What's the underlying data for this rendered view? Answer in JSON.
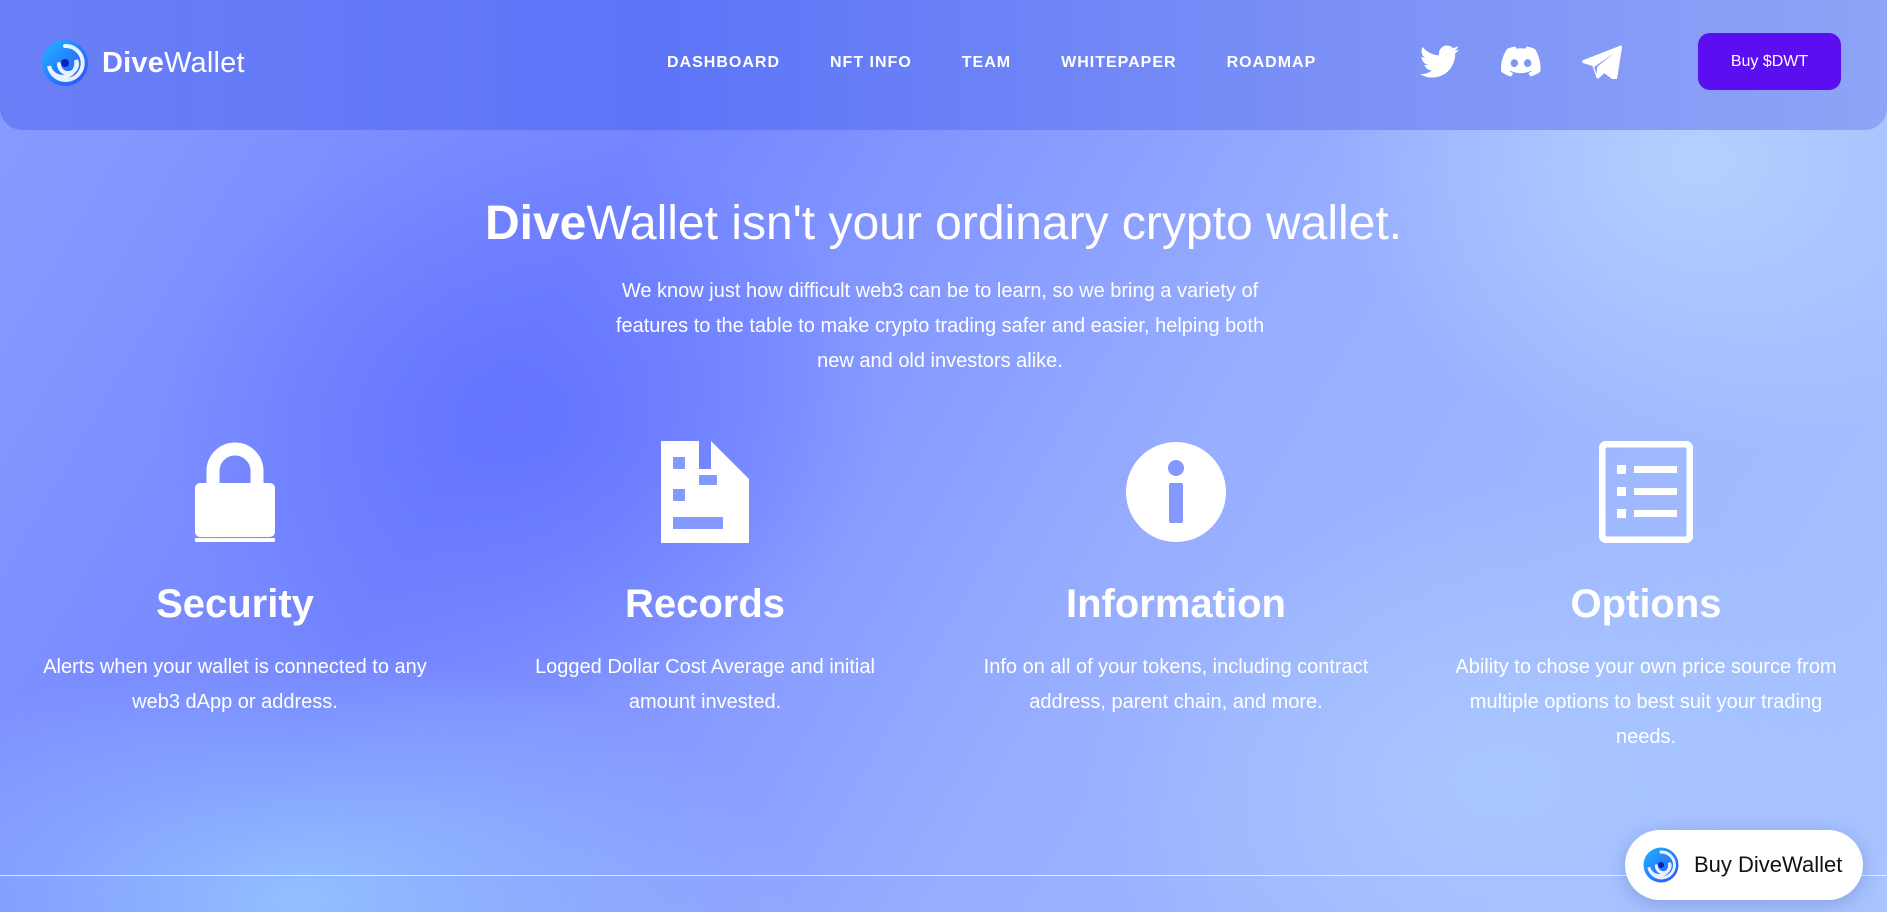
{
  "header": {
    "brand_bold": "Dive",
    "brand_light": "Wallet",
    "nav": [
      "DASHBOARD",
      "NFT INFO",
      "TEAM",
      "WHITEPAPER",
      "ROADMAP"
    ],
    "socials": [
      "twitter-icon",
      "discord-icon",
      "telegram-icon"
    ],
    "buy_label": "Buy $DWT"
  },
  "hero": {
    "title_bold": "Dive",
    "title_rest": "Wallet isn't your ordinary crypto wallet.",
    "description": "We know just how difficult web3 can be to learn, so we bring a variety of features to the table to make crypto trading safer and easier, helping both new and old investors alike."
  },
  "features": [
    {
      "icon": "lock-icon",
      "title": "Security",
      "description": "Alerts when your wallet is connected to any web3 dApp or address."
    },
    {
      "icon": "document-icon",
      "title": "Records",
      "description": "Logged Dollar Cost Average and initial amount invested."
    },
    {
      "icon": "info-icon",
      "title": "Information",
      "description": "Info on all of your tokens, including contract address, parent chain, and more."
    },
    {
      "icon": "list-icon",
      "title": "Options",
      "description": "Ability to chose your own price source from multiple options to best suit your trading needs."
    }
  ],
  "float_button": {
    "label": "Buy DiveWallet"
  },
  "colors": {
    "accent": "#5b0ff0",
    "header_bg": "#6077f8",
    "text": "#ffffff"
  }
}
